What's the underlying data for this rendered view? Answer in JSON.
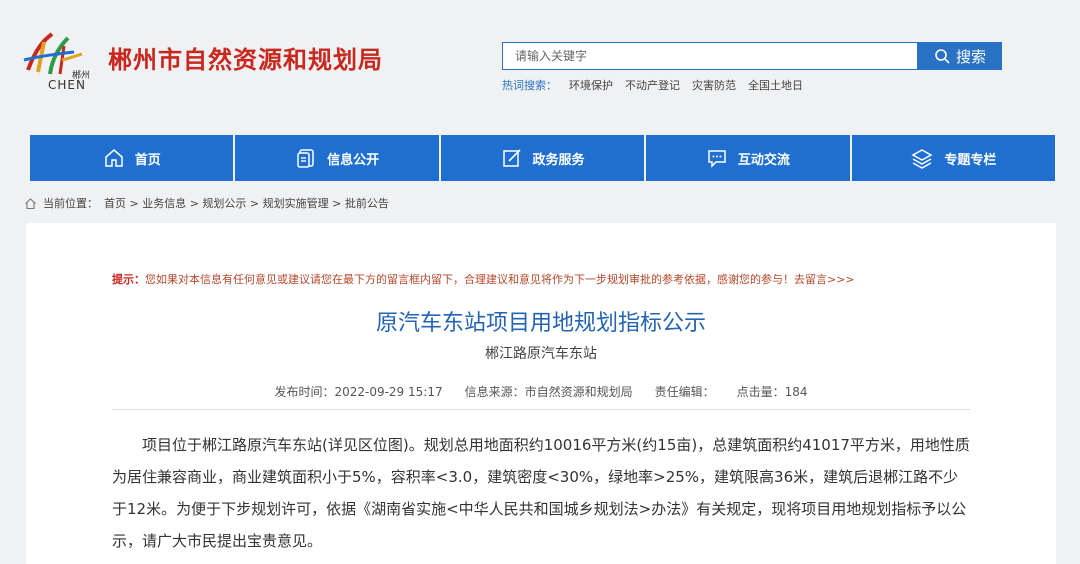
{
  "site": {
    "title": "郴州市自然资源和规划局",
    "logo_text_cn": "郴州",
    "logo_text_en": "CHEN"
  },
  "search": {
    "placeholder": "请输入关键字",
    "button_label": "搜索",
    "hot_label": "热词搜索：",
    "hot_words": [
      "环境保护",
      "不动产登记",
      "灾害防范",
      "全国土地日"
    ]
  },
  "nav": {
    "items": [
      {
        "label": "首页",
        "icon": "home-icon"
      },
      {
        "label": "信息公开",
        "icon": "document-icon"
      },
      {
        "label": "政务服务",
        "icon": "edit-icon"
      },
      {
        "label": "互动交流",
        "icon": "chat-icon"
      },
      {
        "label": "专题专栏",
        "icon": "layers-icon"
      }
    ]
  },
  "breadcrumb": {
    "label": "当前位置：",
    "path": "首页 > 业务信息 > 规划公示 > 规划实施管理 > 批前公告"
  },
  "article": {
    "notice_label": "提示：",
    "notice_text": "您如果对本信息有任何意见或建议请您在最下方的留言框内留下，合理建议和意见将作为下一步规划审批的参考依据，感谢您的参与！去留言>>>",
    "title": "原汽车东站项目用地规划指标公示",
    "subtitle": "郴江路原汽车东站",
    "meta": {
      "publish_time": "发布时间：2022-09-29 15:17",
      "source": "信息来源：市自然资源和规划局",
      "editor": "责任编辑：",
      "views": "点击量：184"
    },
    "body": "项目位于郴江路原汽车东站(详见区位图)。规划总用地面积约10016平方米(约15亩)，总建筑面积约41017平方米，用地性质为居住兼容商业，商业建筑面积小于5%，容积率<3.0，建筑密度<30%，绿地率>25%，建筑限高36米，建筑后退郴江路不少于12米。为便于下步规划许可，依据《湖南省实施<中华人民共和国城乡规划法>办法》有关规定，现将项目用地规划指标予以公示，请广大市民提出宝贵意见。"
  },
  "colors": {
    "brand_red": "#c8281e",
    "nav_blue": "#1e6fd0",
    "title_blue": "#2464b4",
    "background": "#f0f1f3"
  }
}
